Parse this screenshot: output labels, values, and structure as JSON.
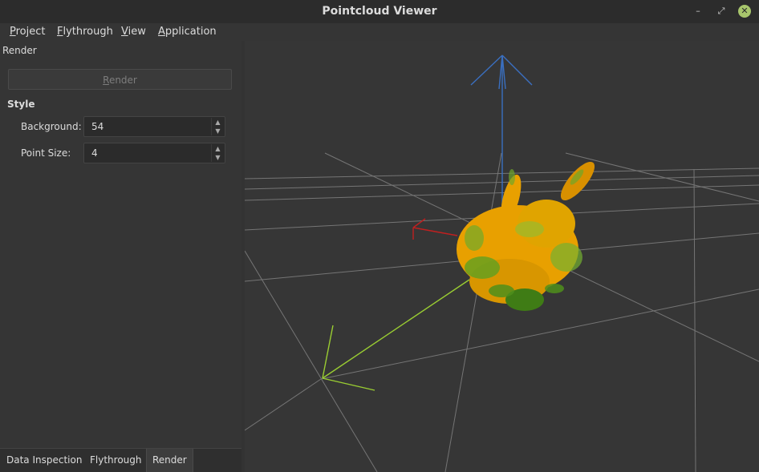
{
  "window": {
    "title": "Pointcloud Viewer"
  },
  "window_controls": {
    "minimize": "–",
    "maximize": "⤢",
    "close": "✕"
  },
  "menu": {
    "items": [
      {
        "first": "P",
        "rest": "roject"
      },
      {
        "first": "F",
        "rest": "lythrough"
      },
      {
        "first": "V",
        "rest": "iew"
      },
      {
        "first": "A",
        "rest": "pplication"
      }
    ]
  },
  "panel": {
    "header": "Render",
    "render_button": {
      "first": "R",
      "rest": "ender"
    },
    "style_group": "Style",
    "fields": [
      {
        "label": "Background:",
        "value": "54"
      },
      {
        "label": "Point Size:",
        "value": "4"
      }
    ]
  },
  "tabs": [
    {
      "label": "Data Inspection"
    },
    {
      "label": "Flythrough"
    },
    {
      "label": "Render",
      "active": true
    }
  ],
  "viewport": {
    "point_color": "#e8a000",
    "point_shadow_color": "#5fa020",
    "axis_x_color": "#c02020",
    "axis_y_color": "#9acd32",
    "axis_z_color": "#3a6fc0",
    "grid_color": "#8a8a8a"
  },
  "icons": {
    "spin_up": "up-arrow-icon",
    "spin_down": "down-arrow-icon",
    "close": "close-icon"
  }
}
